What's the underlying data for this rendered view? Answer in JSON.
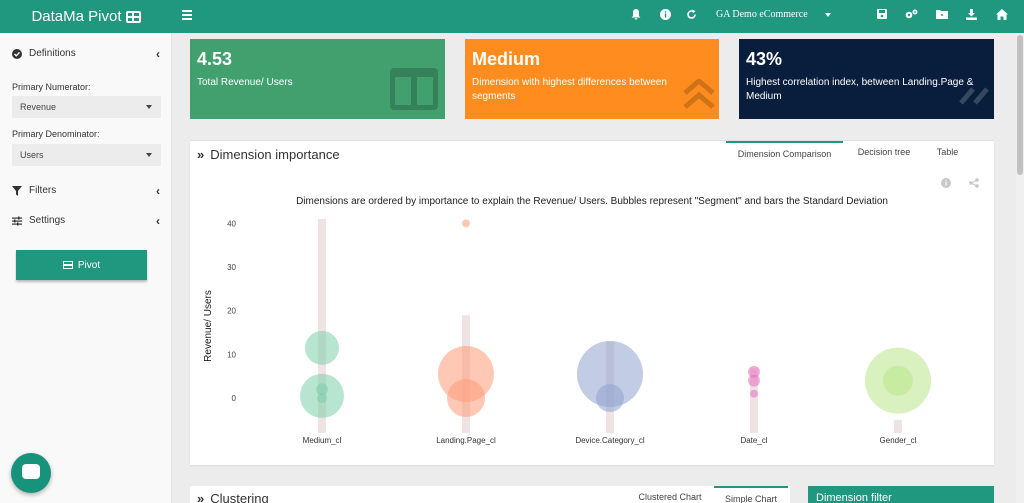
{
  "topbar": {
    "brand": "DataMa Pivot",
    "dataset_label": "GA Demo eCommerce",
    "icons": [
      "bell-icon",
      "info-icon",
      "refresh-icon",
      "save-icon",
      "settings-icon",
      "folder-icon",
      "download-icon",
      "home-icon"
    ]
  },
  "sidebar": {
    "definitions_label": "Definitions",
    "primary_numerator_label": "Primary Numerator:",
    "primary_numerator_value": "Revenue",
    "primary_denominator_label": "Primary Denominator:",
    "primary_denominator_value": "Users",
    "filters_label": "Filters",
    "settings_label": "Settings",
    "pivot_button": "Pivot"
  },
  "kpis": [
    {
      "value": "4.53",
      "label": "Total Revenue/ Users",
      "color": "#42a06f"
    },
    {
      "value": "Medium",
      "label": "Dimension with highest differences between segments",
      "color": "#ff8c1e"
    },
    {
      "value": "43%",
      "label": "Highest correlation index, between Landing.Page & Medium",
      "color": "#091e3c"
    }
  ],
  "panel": {
    "title": "Dimension importance",
    "tabs": [
      "Dimension Comparison",
      "Decision tree",
      "Table"
    ],
    "active_tab": "Dimension Comparison"
  },
  "chart_data": {
    "type": "scatter",
    "title": "Dimensions are ordered by importance to explain the Revenue/ Users. Bubbles represent \"Segment\" and bars the Standard Deviation",
    "ylabel": "Revenue/ Users",
    "xlabel": "",
    "ylim": [
      -8,
      41
    ],
    "yticks": [
      0,
      10,
      20,
      30,
      40
    ],
    "categories": [
      "Medium_cl",
      "Landing.Page_cl",
      "Device.Category_cl",
      "Date_cl",
      "Gender_cl"
    ],
    "colors": {
      "Medium_cl": "#7ccfa8",
      "Landing.Page_cl": "#ff9a78",
      "Device.Category_cl": "#8fa3cf",
      "Date_cl": "#e46fc3",
      "Gender_cl": "#b9e58a"
    },
    "std_bars": [
      {
        "category": "Medium_cl",
        "low": -8,
        "high": 41
      },
      {
        "category": "Landing.Page_cl",
        "low": -8,
        "high": 19
      },
      {
        "category": "Device.Category_cl",
        "low": -8,
        "high": 13
      },
      {
        "category": "Date_cl",
        "low": -8,
        "high": 7
      },
      {
        "category": "Gender_cl",
        "low": -8,
        "high": -5
      }
    ],
    "bubbles": [
      {
        "category": "Medium_cl",
        "y": 11.5,
        "size": 17
      },
      {
        "category": "Medium_cl",
        "y": 0.5,
        "size": 22
      },
      {
        "category": "Medium_cl",
        "y": 2,
        "size": 6
      },
      {
        "category": "Medium_cl",
        "y": 0,
        "size": 5
      },
      {
        "category": "Landing.Page_cl",
        "y": 40,
        "size": 4
      },
      {
        "category": "Landing.Page_cl",
        "y": 5.5,
        "size": 28
      },
      {
        "category": "Landing.Page_cl",
        "y": 0,
        "size": 19
      },
      {
        "category": "Device.Category_cl",
        "y": 5.5,
        "size": 33
      },
      {
        "category": "Device.Category_cl",
        "y": 0,
        "size": 14
      },
      {
        "category": "Date_cl",
        "y": 6,
        "size": 6
      },
      {
        "category": "Date_cl",
        "y": 4,
        "size": 6
      },
      {
        "category": "Date_cl",
        "y": 1,
        "size": 4
      },
      {
        "category": "Gender_cl",
        "y": 4,
        "size": 33
      },
      {
        "category": "Gender_cl",
        "y": 4,
        "size": 15
      }
    ]
  },
  "lower": {
    "clustering_title": "Clustering",
    "tabs": [
      "Clustered Chart",
      "Simple Chart"
    ],
    "dimension_filter": "Dimension filter"
  }
}
